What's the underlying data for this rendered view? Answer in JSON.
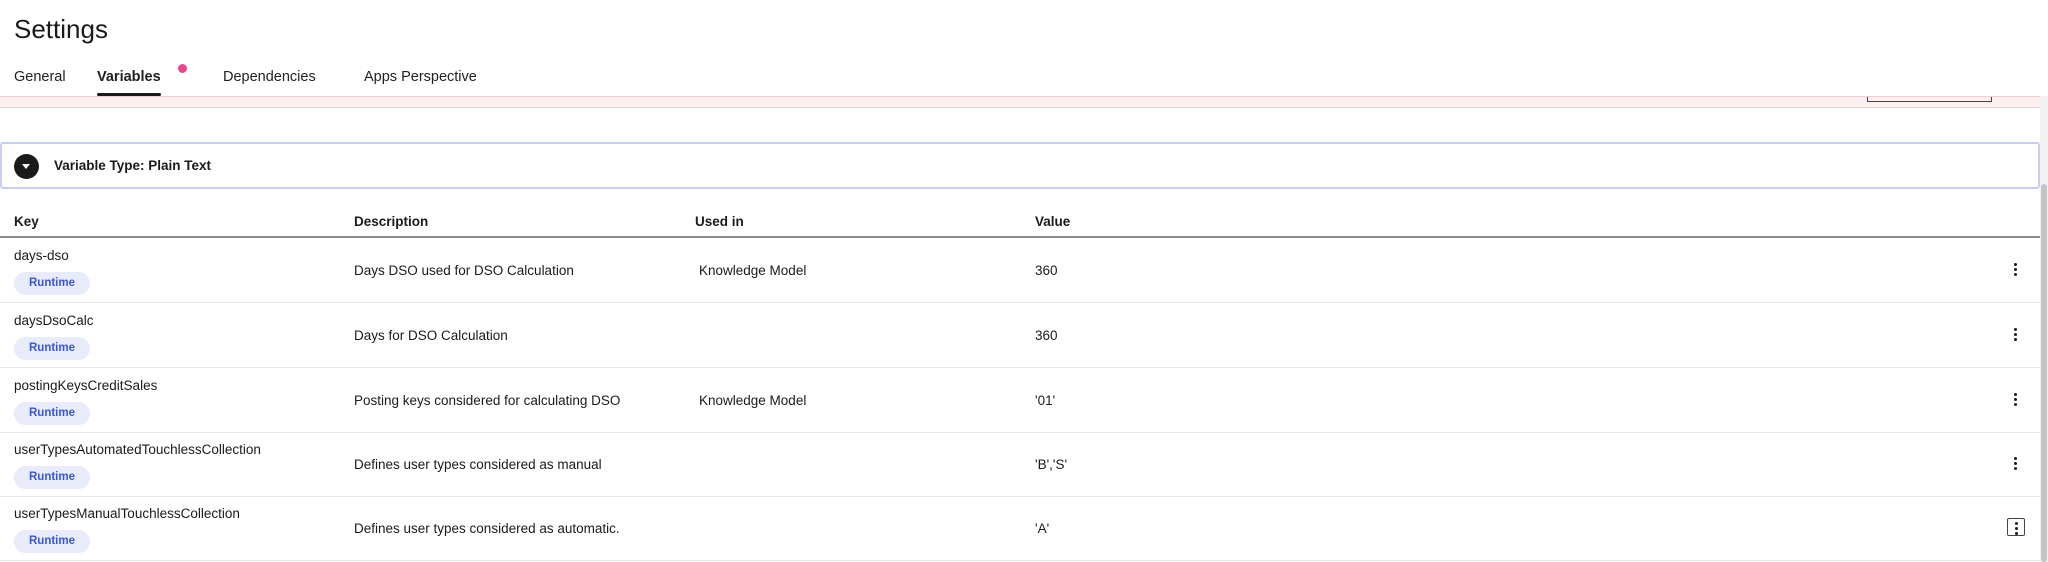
{
  "page": {
    "title": "Settings"
  },
  "tabs": [
    {
      "label": "General",
      "active": false
    },
    {
      "label": "Variables",
      "active": true,
      "indicator": true
    },
    {
      "label": "Dependencies",
      "active": false
    },
    {
      "label": "Apps Perspective",
      "active": false
    }
  ],
  "group": {
    "title": "Variable Type: Plain Text",
    "expanded": true
  },
  "table": {
    "columns": [
      "Key",
      "Description",
      "Used in",
      "Value"
    ],
    "rows": [
      {
        "key": "days-dso",
        "badge": "Runtime",
        "description": "Days DSO used for DSO Calculation",
        "used_in": "Knowledge Model",
        "value": "360"
      },
      {
        "key": "daysDsoCalc",
        "badge": "Runtime",
        "description": "Days for DSO Calculation",
        "used_in": "",
        "value": "360"
      },
      {
        "key": "postingKeysCreditSales",
        "badge": "Runtime",
        "description": "Posting keys considered for calculating DSO",
        "used_in": "Knowledge Model",
        "value": "'01'"
      },
      {
        "key": "userTypesAutomatedTouchlessCollection",
        "badge": "Runtime",
        "description": "Defines user types considered as manual",
        "used_in": "",
        "value": "'B','S'"
      },
      {
        "key": "userTypesManualTouchlessCollection",
        "badge": "Runtime",
        "description": "Defines user types considered as automatic.",
        "used_in": "",
        "value": "'A'"
      }
    ]
  },
  "icons": {
    "expand_toggle": "chevron-down-icon",
    "row_actions": "more-vertical-icon"
  },
  "colors": {
    "active_tab_dot": "#e8478e",
    "badge_bg": "#e8ebfa",
    "badge_text": "#3b56d4",
    "group_border": "#c7cdf5",
    "alert_bg": "#fcf0f1"
  }
}
